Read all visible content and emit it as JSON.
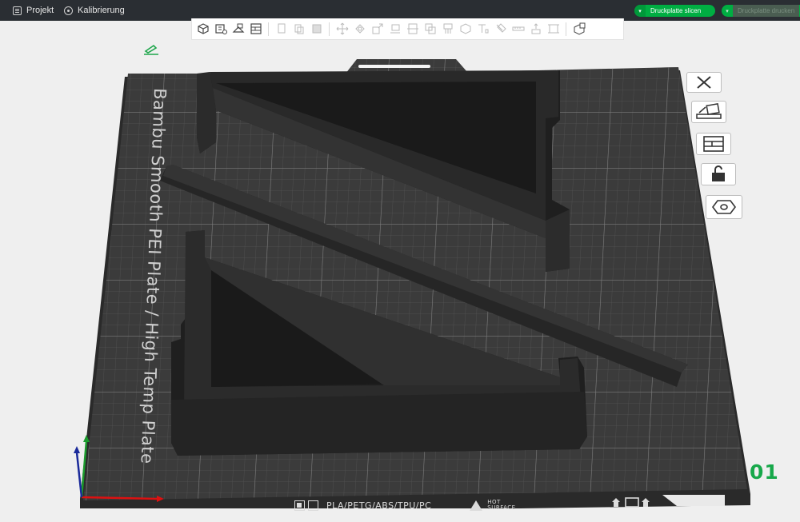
{
  "menu": {
    "project_label": "Projekt",
    "calibration_label": "Kalibrierung"
  },
  "actions": {
    "slice_label": "Druckplatte slicen",
    "print_label": "Druckplatte drucken"
  },
  "plate": {
    "name": "Bambu Smooth PEI Plate / High Temp Plate",
    "materials": "PLA/PETG/ABS/TPU/PC",
    "hot_line1": "HOT",
    "hot_line2": "SURFACE",
    "number": "01"
  },
  "colors": {
    "accent": "#00ae42",
    "titlebar": "#2a2e33",
    "plate": "#3a3a3a",
    "model": "#262626",
    "grid": "#5a5a5a"
  },
  "icons": {
    "toolbar": [
      "add-cube-icon",
      "add-plate-icon",
      "auto-orient-icon",
      "arrange-icon",
      "copy-icon",
      "paste-icon",
      "delete-icon",
      "move-icon",
      "rotate-icon",
      "scale-icon",
      "lay-on-face-icon",
      "cut-icon",
      "mesh-boolean-icon",
      "support-paint-icon",
      "seam-paint-icon",
      "text-icon",
      "color-paint-icon",
      "measure-icon",
      "assembly-icon",
      "bbox-icon",
      "view-icon"
    ],
    "side": [
      "close-icon",
      "auto-orient-icon",
      "arrange-icon",
      "lock-icon",
      "settings-icon"
    ]
  }
}
